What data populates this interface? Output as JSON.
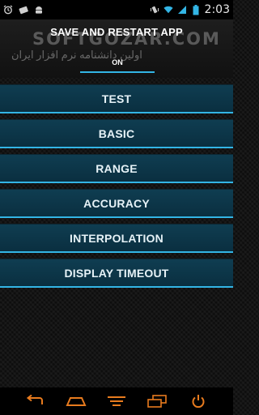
{
  "status_bar": {
    "time": "2:03",
    "icons_left": [
      "alarm-icon",
      "camera-icon",
      "android-icon"
    ],
    "icons_right": [
      "vibrate-icon",
      "wifi-icon",
      "signal-icon",
      "battery-icon"
    ]
  },
  "header": {
    "title": "SAVE AND RESTART APP",
    "watermark_brand": "SOFTGOZAR.COM",
    "watermark_text": "اولین دانشنامه نرم افزار ایران",
    "toggle_label": "ON"
  },
  "menu": {
    "items": [
      {
        "label": "TEST"
      },
      {
        "label": "BASIC"
      },
      {
        "label": "RANGE"
      },
      {
        "label": "ACCURACY"
      },
      {
        "label": "INTERPOLATION"
      },
      {
        "label": "DISPLAY TIMEOUT"
      }
    ]
  },
  "nav_bar": {
    "icons": [
      "back-icon",
      "home-icon",
      "menu-icon",
      "recent-apps-icon",
      "power-icon"
    ],
    "accent": "#e87b1e"
  },
  "colors": {
    "accent": "#33b5e5",
    "button_bg": "#0f3d51"
  }
}
